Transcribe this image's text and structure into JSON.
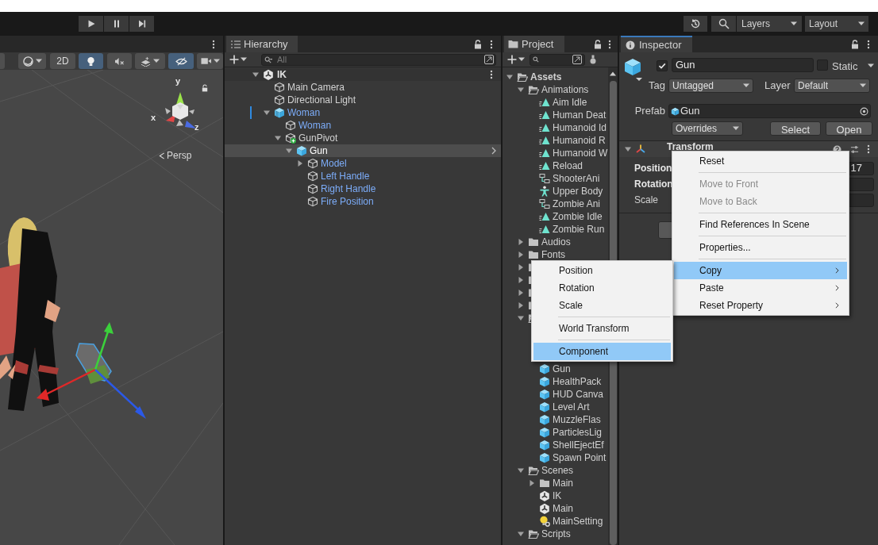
{
  "toolbar": {
    "layers": "Layers",
    "layout": "Layout"
  },
  "scene_view": {
    "tools": [
      {
        "kind": "partial",
        "on": false
      },
      {
        "kind": "shading",
        "on": false
      },
      {
        "kind": "dimension",
        "label": "2D",
        "on": false
      },
      {
        "kind": "lighting",
        "on": true
      },
      {
        "kind": "audio",
        "on": false
      },
      {
        "kind": "effects",
        "on": false
      },
      {
        "kind": "visibility",
        "on": true
      },
      {
        "kind": "camera",
        "on": false
      }
    ],
    "gizmo_axes": [
      "y",
      "x",
      "z"
    ],
    "projection": "Persp"
  },
  "hierarchy": {
    "tab": "Hierarchy",
    "search": {
      "placeholder": "All"
    },
    "scene": {
      "name": "IK",
      "expanded": true,
      "children": [
        {
          "name": "Main Camera",
          "kind": "object",
          "prefab": false,
          "overridden": false,
          "selected": false
        },
        {
          "name": "Directional Light",
          "kind": "object",
          "prefab": false,
          "overridden": false,
          "selected": false
        },
        {
          "name": "Woman",
          "kind": "prefab_variant",
          "prefab": true,
          "overridden": true,
          "selected": false,
          "expanded": true,
          "children": [
            {
              "name": "Woman",
              "kind": "object",
              "prefab": true,
              "overridden": false,
              "selected": false
            },
            {
              "name": "GunPivot",
              "kind": "added",
              "prefab": false,
              "overridden": false,
              "selected": false,
              "expanded": true,
              "children": [
                {
                  "name": "Gun",
                  "kind": "prefab",
                  "overridden": false,
                  "selected": true,
                  "expanded": true,
                  "children": [
                    {
                      "name": "Model",
                      "kind": "object",
                      "prefab": true,
                      "overridden": false,
                      "selected": false,
                      "expanded": false
                    },
                    {
                      "name": "Left Handle",
                      "kind": "object",
                      "prefab": true,
                      "overridden": false,
                      "selected": false
                    },
                    {
                      "name": "Right Handle",
                      "kind": "object",
                      "prefab": true,
                      "overridden": false,
                      "selected": false
                    },
                    {
                      "name": "Fire Position",
                      "kind": "object",
                      "prefab": true,
                      "overridden": false,
                      "selected": false
                    }
                  ]
                }
              ]
            }
          ]
        }
      ]
    }
  },
  "project": {
    "tab": "Project",
    "items": [
      {
        "name": "Assets",
        "kind": "folder",
        "expanded": true,
        "children": [
          {
            "name": "Animations",
            "kind": "folder",
            "expanded": true,
            "children": [
              {
                "name": "Aim Idle",
                "kind": "animation"
              },
              {
                "name": "Human Deat",
                "kind": "animation"
              },
              {
                "name": "Humanoid Id",
                "kind": "animation"
              },
              {
                "name": "Humanoid R",
                "kind": "animation"
              },
              {
                "name": "Humanoid W",
                "kind": "animation"
              },
              {
                "name": "Reload",
                "kind": "animation"
              },
              {
                "name": "ShooterAni",
                "kind": "controller"
              },
              {
                "name": "Upper Body",
                "kind": "avatar"
              },
              {
                "name": "Zombie Ani",
                "kind": "controller"
              },
              {
                "name": "Zombie Idle",
                "kind": "animation"
              },
              {
                "name": "Zombie Run",
                "kind": "animation"
              }
            ]
          },
          {
            "name": "Audios",
            "kind": "folder",
            "expanded": false
          },
          {
            "name": "Fonts",
            "kind": "folder",
            "expanded": false
          },
          {
            "kind": "folder",
            "expanded": false
          },
          {
            "kind": "folder",
            "expanded": false
          },
          {
            "kind": "folder",
            "expanded": false
          },
          {
            "kind": "folder",
            "expanded": false
          },
          {
            "kind": "folder",
            "expanded": true,
            "children": [
              {
                "kind": "covered"
              },
              {
                "kind": "covered"
              },
              {
                "kind": "covered"
              },
              {
                "name": "Gun",
                "kind": "prefab"
              },
              {
                "name": "HealthPack",
                "kind": "prefab"
              },
              {
                "name": "HUD Canva",
                "kind": "prefab"
              },
              {
                "name": "Level Art",
                "kind": "prefab"
              },
              {
                "name": "MuzzleFlas",
                "kind": "prefab"
              },
              {
                "name": "ParticlesLig",
                "kind": "prefab"
              },
              {
                "name": "ShellEjectEf",
                "kind": "prefab"
              },
              {
                "name": "Spawn Point",
                "kind": "prefab"
              }
            ]
          },
          {
            "name": "Scenes",
            "kind": "folder",
            "expanded": true,
            "children": [
              {
                "name": "Main",
                "kind": "folder",
                "expanded": false
              },
              {
                "name": "IK",
                "kind": "scene"
              },
              {
                "name": "Main",
                "kind": "scene"
              },
              {
                "name": "MainSetting",
                "kind": "settings"
              }
            ]
          },
          {
            "name": "Scripts",
            "kind": "folder",
            "expanded": true
          }
        ]
      }
    ]
  },
  "inspector": {
    "tab": "Inspector",
    "object": {
      "name": "Gun",
      "enabled": true,
      "static": false,
      "static_label": "Static"
    },
    "tag": {
      "label": "Tag",
      "value": "Untagged"
    },
    "layer": {
      "label": "Layer",
      "value": "Default"
    },
    "prefab": {
      "label": "Prefab",
      "value": "Gun",
      "overrides": "Overrides",
      "buttons": [
        "Select",
        "Open"
      ]
    },
    "transform": {
      "title": "Transform",
      "expanded": true,
      "fields": [
        {
          "label": "Position",
          "overridden": true,
          "value": "17"
        },
        {
          "label": "Rotation",
          "overridden": true
        },
        {
          "label": "Scale",
          "overridden": false
        }
      ]
    }
  },
  "context_menu": {
    "items": [
      {
        "kind": "item",
        "label": "Reset",
        "disabled": false,
        "selected": false,
        "submenu": false
      },
      {
        "kind": "separator"
      },
      {
        "kind": "item",
        "label": "Move to Front",
        "disabled": true,
        "selected": false,
        "submenu": false
      },
      {
        "kind": "item",
        "label": "Move to Back",
        "disabled": true,
        "selected": false,
        "submenu": false
      },
      {
        "kind": "separator"
      },
      {
        "kind": "item",
        "label": "Find References In Scene",
        "disabled": false,
        "selected": false,
        "submenu": false
      },
      {
        "kind": "separator"
      },
      {
        "kind": "item",
        "label": "Properties...",
        "disabled": false,
        "selected": false,
        "submenu": false
      },
      {
        "kind": "separator"
      },
      {
        "kind": "item",
        "label": "Copy",
        "disabled": false,
        "selected": true,
        "submenu": true
      },
      {
        "kind": "item",
        "label": "Paste",
        "disabled": false,
        "selected": false,
        "submenu": true
      },
      {
        "kind": "item",
        "label": "Reset Property",
        "disabled": false,
        "selected": false,
        "submenu": true
      }
    ]
  },
  "submenu": {
    "items": [
      {
        "kind": "item",
        "label": "Position",
        "disabled": false,
        "selected": false,
        "submenu": false
      },
      {
        "kind": "item",
        "label": "Rotation",
        "disabled": false,
        "selected": false,
        "submenu": false
      },
      {
        "kind": "item",
        "label": "Scale",
        "disabled": false,
        "selected": false,
        "submenu": false
      },
      {
        "kind": "separator"
      },
      {
        "kind": "item",
        "label": "World Transform",
        "disabled": false,
        "selected": false,
        "submenu": false
      },
      {
        "kind": "separator"
      },
      {
        "kind": "item",
        "label": "Component",
        "disabled": false,
        "selected": true,
        "submenu": false
      }
    ]
  }
}
